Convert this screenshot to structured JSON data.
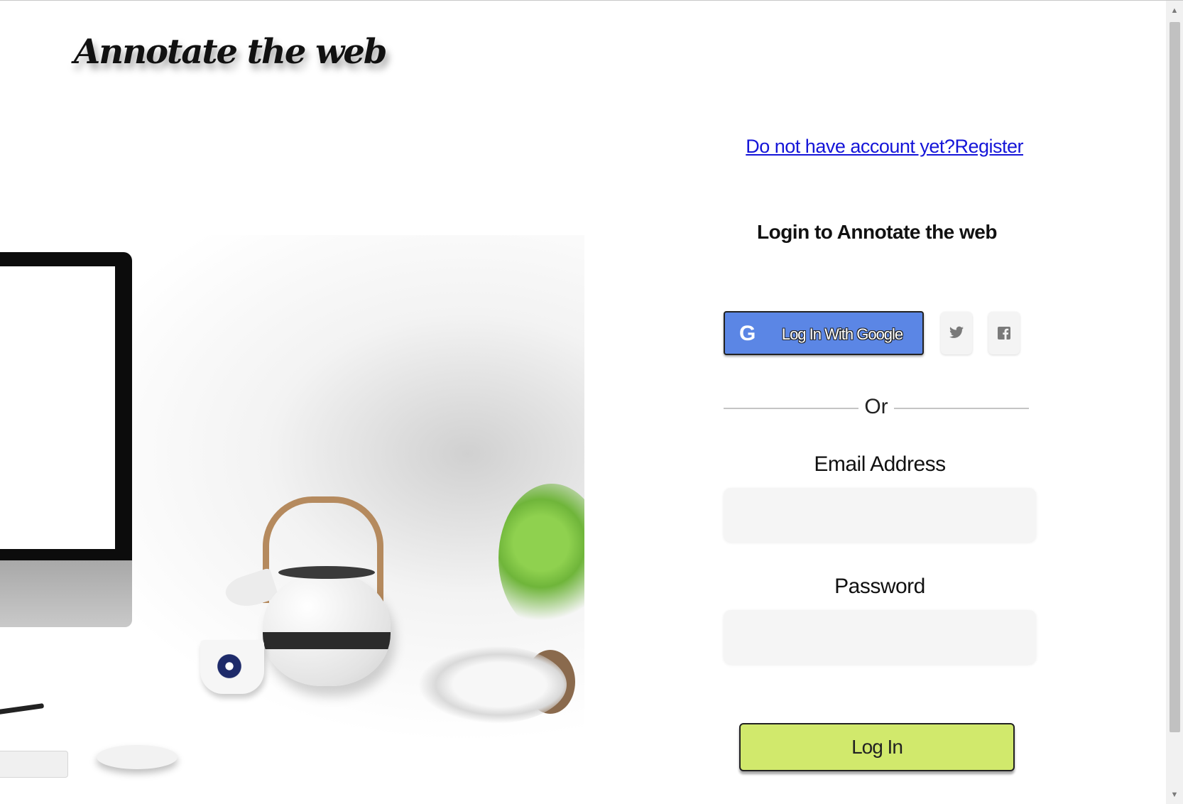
{
  "header": {
    "logo_text": "Annotate the web"
  },
  "register_link": "Do not have account yet?Register",
  "login": {
    "title": "Login to Annotate the web",
    "google_button_label": "Log In With Google",
    "google_icon": "G",
    "twitter_icon": "twitter-icon",
    "facebook_icon": "facebook-icon",
    "divider_text": "Or",
    "email_label": "Email Address",
    "email_value": "",
    "password_label": "Password",
    "password_value": "",
    "submit_label": "Log In"
  },
  "colors": {
    "google_button": "#5b86e5",
    "login_button": "#d1e96c",
    "link": "#1515d8"
  }
}
